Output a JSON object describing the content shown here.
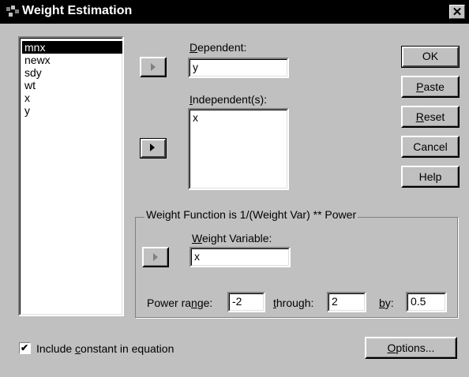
{
  "window": {
    "title": "Weight Estimation",
    "close_glyph": "✕"
  },
  "variables": [
    "mnx",
    "newx",
    "sdy",
    "wt",
    "x",
    "y"
  ],
  "dependent": {
    "label_u": "D",
    "label_rest": "ependent:",
    "value": "y"
  },
  "independent": {
    "label_u": "I",
    "label_rest": "ndependent(s):",
    "items": [
      "x"
    ]
  },
  "buttons": {
    "ok": "OK",
    "paste_u": "P",
    "paste_rest": "aste",
    "reset_u": "R",
    "reset_rest": "eset",
    "cancel": "Cancel",
    "help": "Help",
    "options_u": "O",
    "options_rest": "ptions..."
  },
  "weight_group": {
    "caption": "Weight Function is 1/(Weight Var) ** Power",
    "weight_var_label_u": "W",
    "weight_var_label_rest": "eight Variable:",
    "weight_var_value": "x",
    "power_label_pre": "Power ra",
    "power_label_u": "n",
    "power_label_post": "ge:",
    "power_from": "-2",
    "through_label_u": "t",
    "through_label_rest": "hrough:",
    "power_to": "2",
    "by_label_u": "b",
    "by_label_rest": "y:",
    "power_by": "0.5"
  },
  "constant": {
    "checked": true,
    "label_pre": "Include ",
    "label_u": "c",
    "label_post": "onstant in equation"
  },
  "icons": {
    "app": "spss-app-icon",
    "arrow": "right-arrow-icon",
    "check": "check-icon"
  }
}
